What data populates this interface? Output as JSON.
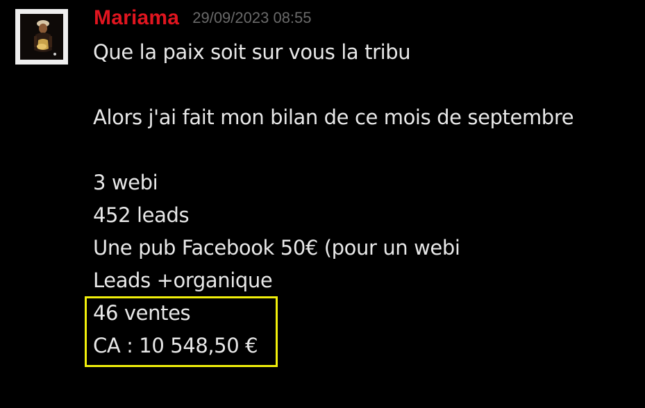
{
  "message": {
    "author": {
      "name": "Mariama",
      "color": "#e0151f",
      "avatar_icon": "user-avatar-photo-icon"
    },
    "timestamp": "29/09/2023 08:55",
    "lines": [
      "Que la paix soit sur vous la tribu",
      "",
      "Alors j'ai fait mon bilan de ce mois de septembre",
      "",
      "3 webi",
      "452 leads",
      "Une pub Facebook 50€ (pour un webi",
      "Leads +organique",
      "46 ventes",
      "CA : 10 548,50 €"
    ],
    "highlight": {
      "color": "#f2f00b",
      "covers_lines": [
        "46 ventes",
        "CA : 10 548,50 €"
      ]
    }
  }
}
